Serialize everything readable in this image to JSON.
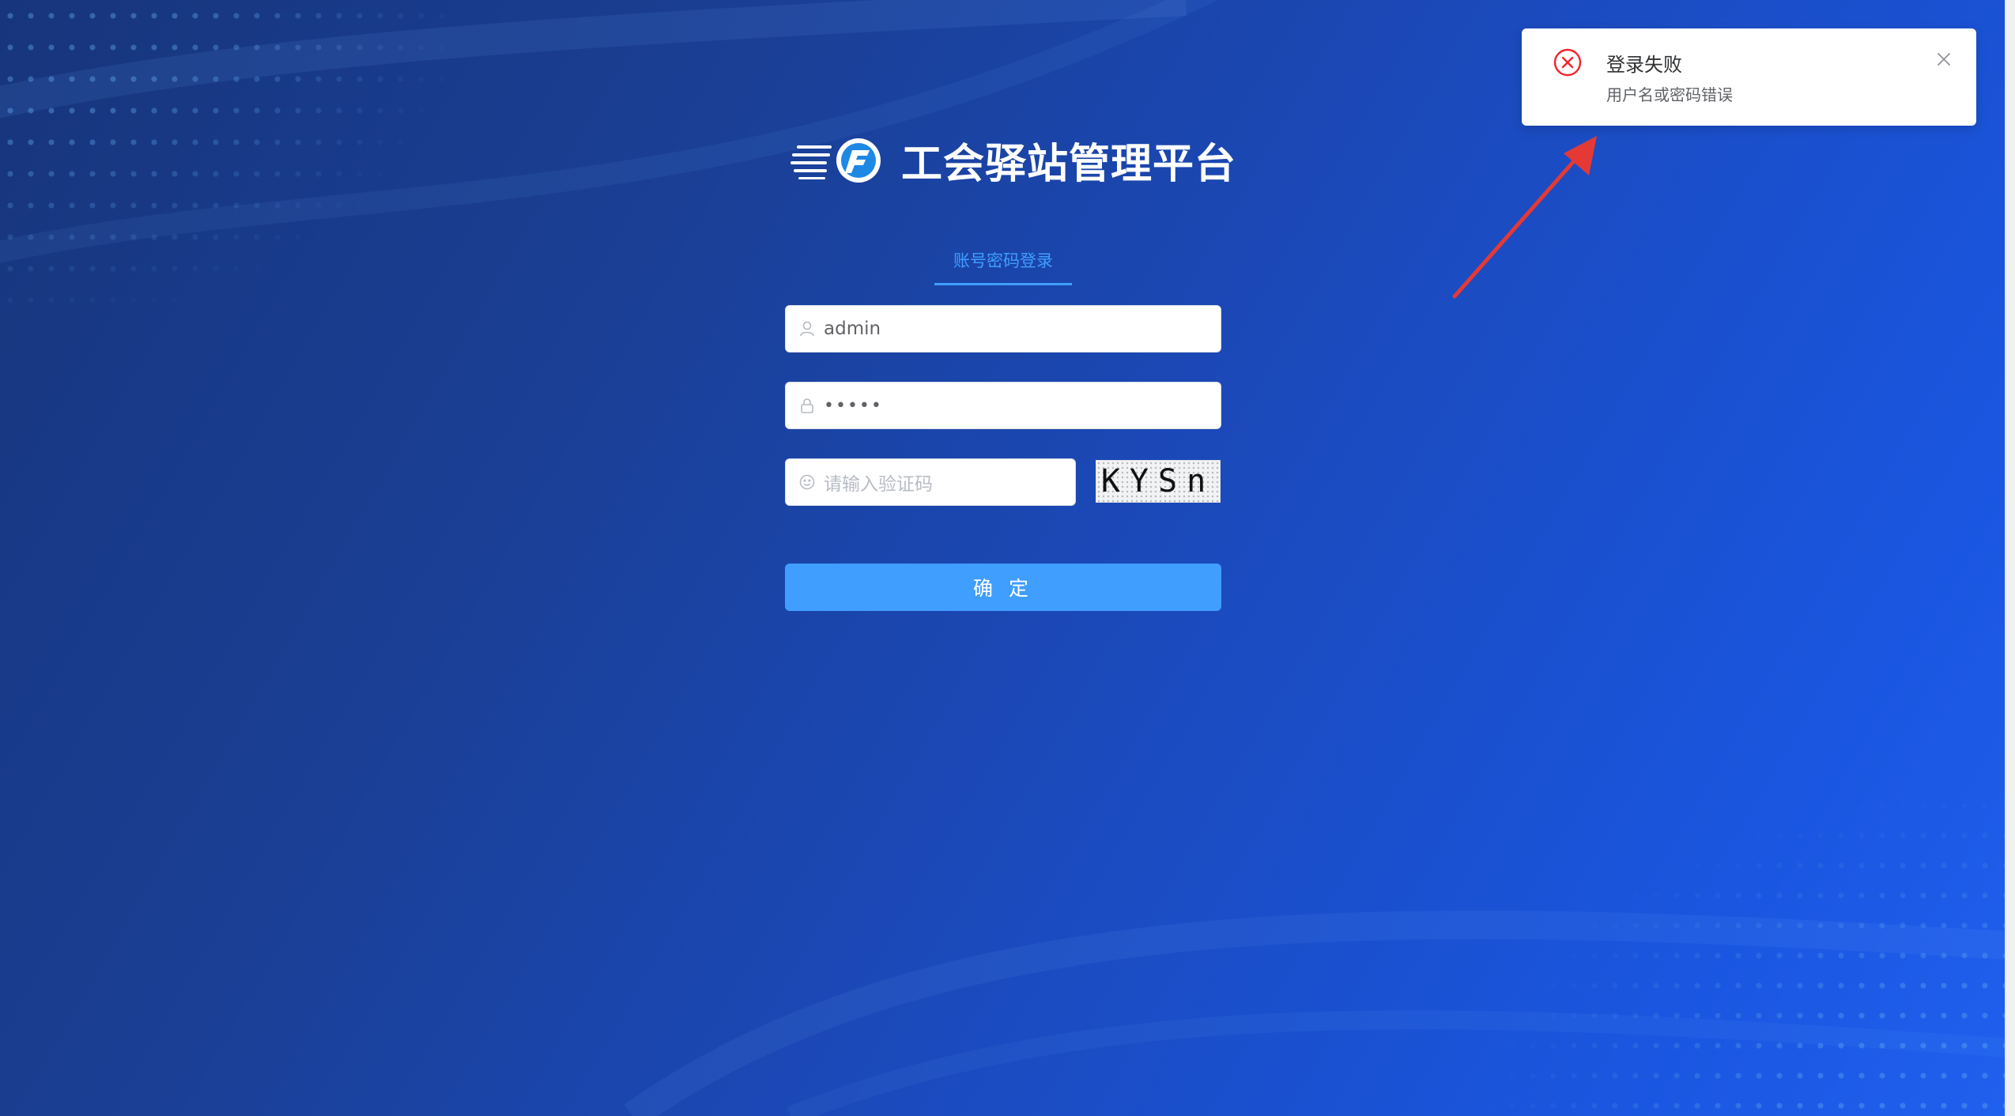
{
  "app": {
    "title": "工会驿站管理平台"
  },
  "login": {
    "tab_label": "账号密码登录",
    "username": {
      "value": "admin",
      "icon": "user-icon"
    },
    "password": {
      "masked_value": "•••••",
      "icon": "lock-icon"
    },
    "captcha_input": {
      "placeholder": "请输入验证码",
      "icon": "smile-icon"
    },
    "captcha_image_text": "KYSn",
    "submit_label": "确 定"
  },
  "notification": {
    "type": "error",
    "icon": "error-circle-icon",
    "title": "登录失败",
    "message": "用户名或密码错误",
    "close_icon": "close-icon"
  },
  "colors": {
    "accent": "#409eff",
    "error": "#f5222d",
    "background_start": "#17357c",
    "background_end": "#2060ee",
    "annotation_arrow": "#e53935"
  }
}
